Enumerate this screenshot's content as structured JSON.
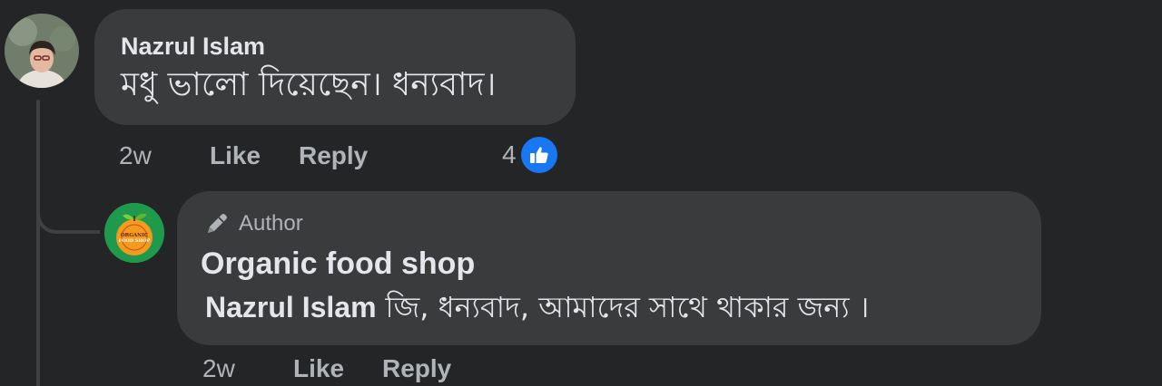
{
  "comment": {
    "author": "Nazrul Islam",
    "text": "মধু ভালো দিয়েছেন। ধন্যবাদ।",
    "time": "2w",
    "like_label": "Like",
    "reply_label": "Reply",
    "reaction_count": "4",
    "reaction_icon": "thumbs-up-icon"
  },
  "reply": {
    "badge_label": "Author",
    "badge_icon": "pen-icon",
    "author": "Organic food shop",
    "mention": "Nazrul Islam",
    "text": "জি, ধন্যবাদ, আমাদের সাথে থাকার জন্য ।",
    "time": "2w",
    "like_label": "Like",
    "reply_label": "Reply",
    "avatar_logo_text": "ORGANIC FOOD SHOP"
  },
  "colors": {
    "background": "#242526",
    "bubble": "#3a3b3c",
    "primary_text": "#e4e6eb",
    "secondary_text": "#b0b3b8",
    "like_blue": "#1877f2"
  }
}
